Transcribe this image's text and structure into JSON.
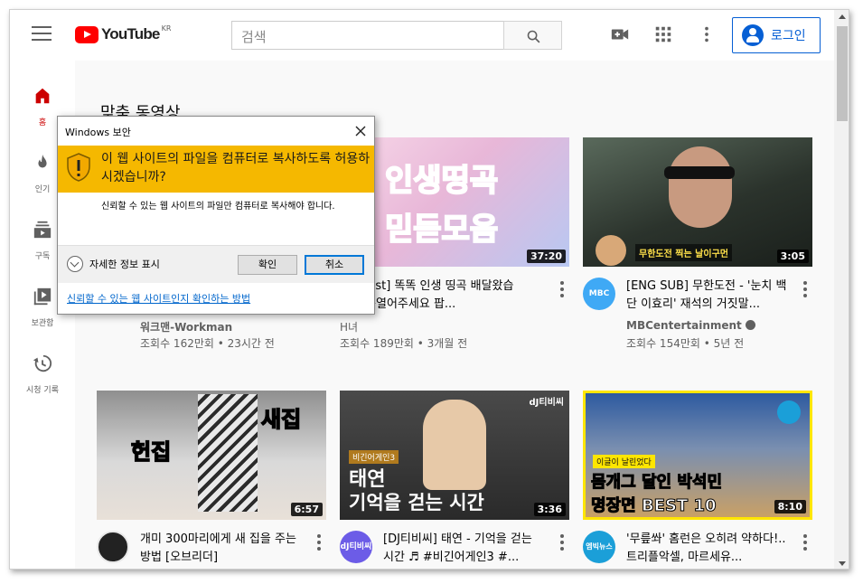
{
  "header": {
    "logo_text": "YouTube",
    "logo_region": "KR",
    "search_placeholder": "검색",
    "login_label": "로그인"
  },
  "sidebar": {
    "items": [
      {
        "label": "홈",
        "icon": "home-icon",
        "active": true
      },
      {
        "label": "인기",
        "icon": "fire-icon"
      },
      {
        "label": "구독",
        "icon": "subscriptions-icon"
      },
      {
        "label": "보관함",
        "icon": "library-icon"
      },
      {
        "label": "시청 기록",
        "icon": "history-icon"
      }
    ]
  },
  "section_title": "맞춤 동영상",
  "videos": [
    {
      "title": "",
      "channel": "워크맨-Workman",
      "stats": "조회수 162만회 • 23시간 전",
      "duration": ""
    },
    {
      "title": "[Playlist] 똑똑 인생 띵곡 배달왔습니다 문열어주세요 팝...",
      "channel": "H녀",
      "stats": "조회수 189만회 • 3개월 전",
      "duration": "37:20",
      "thumb_text_1": "인생띵곡",
      "thumb_text_2": "믿듣모음"
    },
    {
      "title": "[ENG SUB] 무한도전 - '눈치 백단 이효리' 재석의 거짓말...",
      "channel": "MBCentertainment",
      "stats": "조회수 154만회 • 5년 전",
      "duration": "3:05",
      "thumb_caption": "무한도전 찍는 날이구먼",
      "avatar_text": "MBC"
    },
    {
      "title": "개미 300마리에게 새 집을 주는 방법 [오브리더]",
      "channel": "",
      "stats": "",
      "duration": "6:57",
      "thumb_text_1": "헌집",
      "thumb_text_2": "새집"
    },
    {
      "title": "[DJ티비씨] 태연 - 기억을 걷는 시간 ♬ #비긴어게인3 #...",
      "channel": "",
      "stats": "",
      "duration": "3:36",
      "thumb_text_1": "태연",
      "thumb_text_2": "기억을 걷는 시간",
      "thumb_tag": "비긴어게인3",
      "thumb_logo": "dJ티비씨"
    },
    {
      "title": "'무릎쏴' 홈런은 오히려 약하다!.. 트리플악셀, 마르세유...",
      "channel": "",
      "stats": "",
      "duration": "8:10",
      "thumb_text_1": "몸개그 달인 박석민",
      "thumb_text_2": "명장면 BEST 10",
      "thumb_tag": "이글이 날린었다",
      "avatar_text": "엠빅뉴스"
    }
  ],
  "dialog": {
    "title": "Windows 보안",
    "main_text": "이 웹 사이트의 파일을 컴퓨터로 복사하도록 허용하시겠습니까?",
    "sub_text": "신뢰할 수 있는 웹 사이트의 파일만 컴퓨터로 복사해야 합니다.",
    "details_label": "자세한 정보 표시",
    "confirm_label": "확인",
    "cancel_label": "취소",
    "link_text": "신뢰할 수 있는 웹 사이트인지 확인하는 방법"
  },
  "colors": {
    "brand_red": "#ff0000",
    "accent_blue": "#065fd4",
    "dialog_banner": "#f5b800"
  }
}
